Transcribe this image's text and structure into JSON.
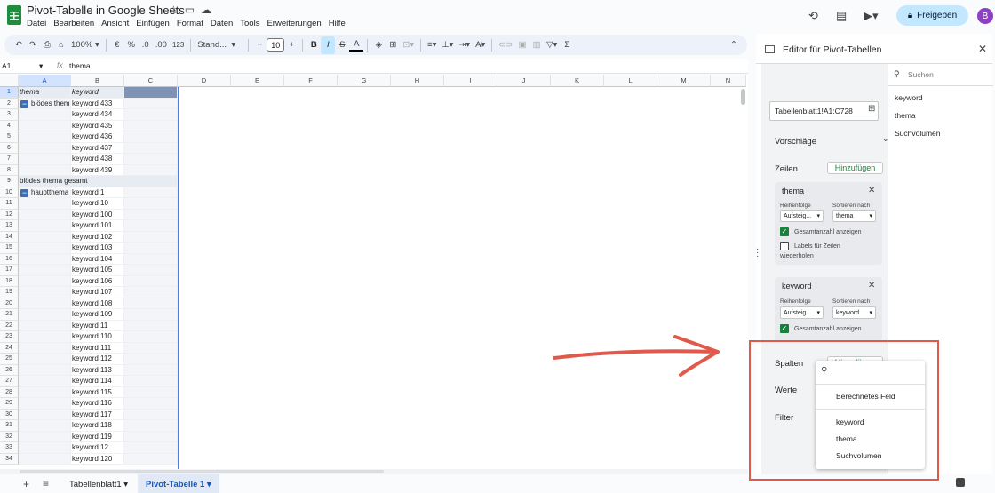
{
  "app": {
    "title": "Pivot-Tabelle in Google Sheets",
    "menu": [
      "Datei",
      "Bearbeiten",
      "Ansicht",
      "Einfügen",
      "Format",
      "Daten",
      "Tools",
      "Erweiterungen",
      "Hilfe"
    ],
    "share_label": "Freigeben",
    "avatar_letter": "B"
  },
  "toolbar": {
    "zoom": "100%",
    "currency": "€",
    "percent": "%",
    "dec_less": ".0",
    "dec_more": ".00",
    "number_format": "123",
    "font": "Stand...",
    "font_size": "10",
    "minus": "−",
    "plus": "+"
  },
  "formula": {
    "cell_ref": "A1",
    "fx_label": "fx",
    "value": "thema"
  },
  "grid": {
    "columns": [
      "A",
      "B",
      "C",
      "D",
      "E",
      "F",
      "G",
      "H",
      "I",
      "J",
      "K",
      "L",
      "M",
      "N"
    ],
    "rows": [
      "1",
      "2",
      "3",
      "4",
      "5",
      "6",
      "7",
      "8",
      "9",
      "10",
      "11",
      "12",
      "13",
      "14",
      "15",
      "16",
      "17",
      "18",
      "19",
      "20",
      "21",
      "22",
      "23",
      "24",
      "25",
      "26",
      "27",
      "28",
      "29",
      "30",
      "31",
      "32",
      "33",
      "34"
    ],
    "header_a": "thema",
    "header_b": "keyword",
    "group1": "blödes thema",
    "group1_keywords": [
      "keyword 433",
      "keyword 434",
      "keyword 435",
      "keyword 436",
      "keyword 437",
      "keyword 438",
      "keyword 439"
    ],
    "group1_total": "blödes thema gesamt",
    "group2": "hauptthema",
    "group2_keywords": [
      "keyword 1",
      "keyword 10",
      "keyword 100",
      "keyword 101",
      "keyword 102",
      "keyword 103",
      "keyword 104",
      "keyword 105",
      "keyword 106",
      "keyword 107",
      "keyword 108",
      "keyword 109",
      "keyword 11",
      "keyword 110",
      "keyword 111",
      "keyword 112",
      "keyword 113",
      "keyword 114",
      "keyword 115",
      "keyword 116",
      "keyword 117",
      "keyword 118",
      "keyword 119",
      "keyword 12",
      "keyword 120"
    ]
  },
  "tabs": {
    "sheet1": "Tabellenblatt1",
    "sheet2": "Pivot-Tabelle 1"
  },
  "panel": {
    "title": "Editor für Pivot-Tabellen",
    "range": "Tabellenblatt1!A1:C728",
    "suggestions": "Vorschläge",
    "rows_label": "Zeilen",
    "add_label": "Hinzufügen",
    "columns_label": "Spalten",
    "values_label": "Werte",
    "filter_label": "Filter",
    "card1": {
      "title": "thema",
      "order_label": "Reihenfolge",
      "sort_label": "Sortieren nach",
      "order_value": "Aufsteig...",
      "sort_value": "thema",
      "show_totals": "Gesamtanzahl anzeigen",
      "repeat_labels_1": "Labels für Zeilen",
      "repeat_labels_2": "wiederholen"
    },
    "card2": {
      "title": "keyword",
      "order_label": "Reihenfolge",
      "sort_label": "Sortieren nach",
      "order_value": "Aufsteig...",
      "sort_value": "keyword",
      "show_totals": "Gesamtanzahl anzeigen"
    },
    "search_placeholder": "Suchen",
    "fields": [
      "keyword",
      "thema",
      "Suchvolumen"
    ]
  },
  "dropdown": {
    "calculated_field": "Berechnetes Feld",
    "items": [
      "keyword",
      "thema",
      "Suchvolumen"
    ]
  },
  "colors": {
    "accent": "#0b57d0",
    "green": "#188038",
    "annotation_red": "#e05a4b"
  }
}
